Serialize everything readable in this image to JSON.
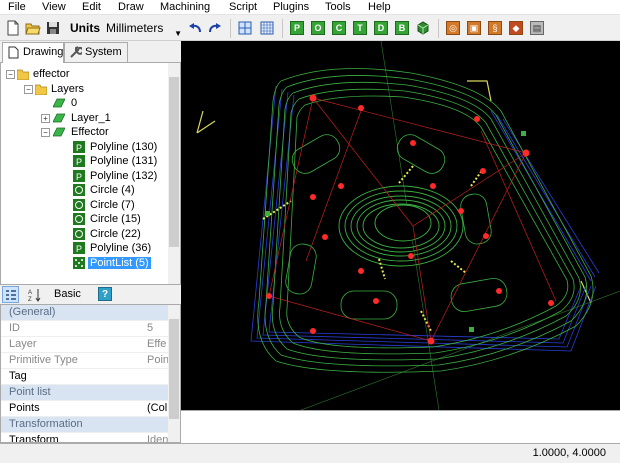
{
  "menu": [
    "File",
    "View",
    "Edit",
    "Draw",
    "Machining",
    "Script",
    "Plugins",
    "Tools",
    "Help"
  ],
  "toolbar": {
    "units_label": "Units",
    "units_value": "Millimeters",
    "green_buttons": [
      "P",
      "O",
      "C",
      "T",
      "D",
      "B"
    ]
  },
  "tabs": {
    "drawing": "Drawing",
    "system": "System"
  },
  "tree": {
    "root": "effector",
    "layers": "Layers",
    "layer0": "0",
    "layer1": "Layer_1",
    "effector_layer": "Effector",
    "items": [
      "Polyline (130)",
      "Polyline (131)",
      "Polyline (132)",
      "Circle (4)",
      "Circle (7)",
      "Circle (15)",
      "Circle (22)",
      "Polyline (36)"
    ],
    "selected": "PointList (5)"
  },
  "props_toolbar": {
    "basic": "Basic",
    "help": "?"
  },
  "properties": [
    {
      "name": "(General)",
      "value": "",
      "category": true
    },
    {
      "name": "ID",
      "value": "5",
      "category": false
    },
    {
      "name": "Layer",
      "value": "Effe",
      "category": false
    },
    {
      "name": "Primitive Type",
      "value": "Poin",
      "category": false
    },
    {
      "name": "Tag",
      "value": "",
      "category": false
    },
    {
      "name": "Point list",
      "value": "",
      "category": true
    },
    {
      "name": "Points",
      "value": "(Col",
      "category": false
    },
    {
      "name": "Transformation",
      "value": "",
      "category": true
    },
    {
      "name": "Transform",
      "value": "Iden",
      "category": false
    }
  ],
  "status": {
    "coords": "1.0000, 4.0000"
  },
  "colors": {
    "canvas_bg": "#000000",
    "green": "#3cb043",
    "blue": "#1e3cff",
    "red": "#ff2a2a",
    "yellow": "#e8e850",
    "selection": "#3399ff"
  }
}
